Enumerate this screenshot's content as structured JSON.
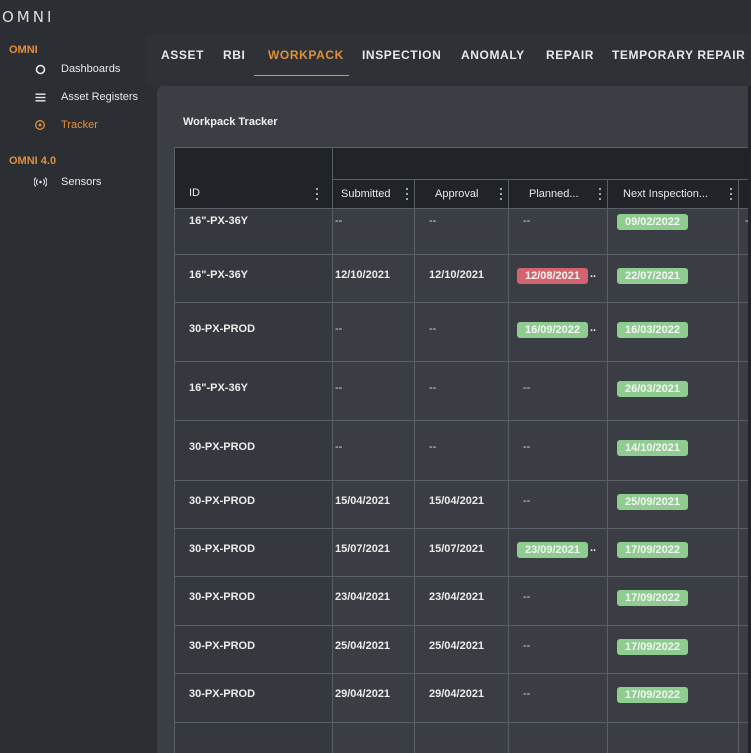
{
  "app": {
    "logo": "OMNI"
  },
  "sidebar": {
    "sections": [
      {
        "title": "OMNI",
        "items": [
          {
            "label": "Dashboards",
            "icon": "circle-icon",
            "active": false
          },
          {
            "label": "Asset Registers",
            "icon": "menu-icon",
            "active": false
          },
          {
            "label": "Tracker",
            "icon": "target-icon",
            "active": true
          }
        ]
      },
      {
        "title": "OMNI 4.0",
        "items": [
          {
            "label": "Sensors",
            "icon": "signal-icon",
            "active": false
          }
        ]
      }
    ]
  },
  "tabs": [
    "ASSET",
    "RBI",
    "WORKPACK",
    "INSPECTION",
    "ANOMALY",
    "REPAIR",
    "TEMPORARY REPAIR"
  ],
  "active_tab": "WORKPACK",
  "panel": {
    "title": "Workpack Tracker"
  },
  "table": {
    "columns": [
      "ID",
      "Submitted",
      "Approval",
      "Planned...",
      "Next Inspection..."
    ],
    "empty_value": "--",
    "rows": [
      {
        "id": "16\"-PX-36Y",
        "submitted": "--",
        "approval": "--",
        "planned": "--",
        "planned_status": "",
        "next": "09/02/2022",
        "next_status": "green",
        "edge": "dash"
      },
      {
        "id": "16\"-PX-36Y",
        "submitted": "12/10/2021",
        "approval": "12/10/2021",
        "planned": "12/08/2021",
        "planned_status": "red",
        "next": "22/07/2021",
        "next_status": "green",
        "edge": "green"
      },
      {
        "id": "30-PX-PROD",
        "submitted": "--",
        "approval": "--",
        "planned": "16/09/2022",
        "planned_status": "green",
        "next": "16/03/2022",
        "next_status": "green",
        "edge": "green"
      },
      {
        "id": "16\"-PX-36Y",
        "submitted": "--",
        "approval": "--",
        "planned": "--",
        "planned_status": "",
        "next": "26/03/2021",
        "next_status": "green",
        "edge": "green"
      },
      {
        "id": "30-PX-PROD",
        "submitted": "--",
        "approval": "--",
        "planned": "--",
        "planned_status": "",
        "next": "14/10/2021",
        "next_status": "green",
        "edge": "green"
      },
      {
        "id": "30-PX-PROD",
        "submitted": "15/04/2021",
        "approval": "15/04/2021",
        "planned": "--",
        "planned_status": "",
        "next": "25/09/2021",
        "next_status": "green",
        "edge": "green"
      },
      {
        "id": "30-PX-PROD",
        "submitted": "15/07/2021",
        "approval": "15/07/2021",
        "planned": "23/09/2021",
        "planned_status": "green",
        "next": "17/09/2022",
        "next_status": "green",
        "edge": "green"
      },
      {
        "id": "30-PX-PROD",
        "submitted": "23/04/2021",
        "approval": "23/04/2021",
        "planned": "--",
        "planned_status": "",
        "next": "17/09/2022",
        "next_status": "green",
        "edge": "green"
      },
      {
        "id": "30-PX-PROD",
        "submitted": "25/04/2021",
        "approval": "25/04/2021",
        "planned": "--",
        "planned_status": "",
        "next": "17/09/2022",
        "next_status": "green",
        "edge": "green"
      },
      {
        "id": "30-PX-PROD",
        "submitted": "29/04/2021",
        "approval": "29/04/2021",
        "planned": "--",
        "planned_status": "",
        "next": "17/09/2022",
        "next_status": "green",
        "edge": "green"
      }
    ]
  },
  "colors": {
    "accent": "#e0903a",
    "status_green": "#8fcc90",
    "status_red": "#d2636f"
  }
}
